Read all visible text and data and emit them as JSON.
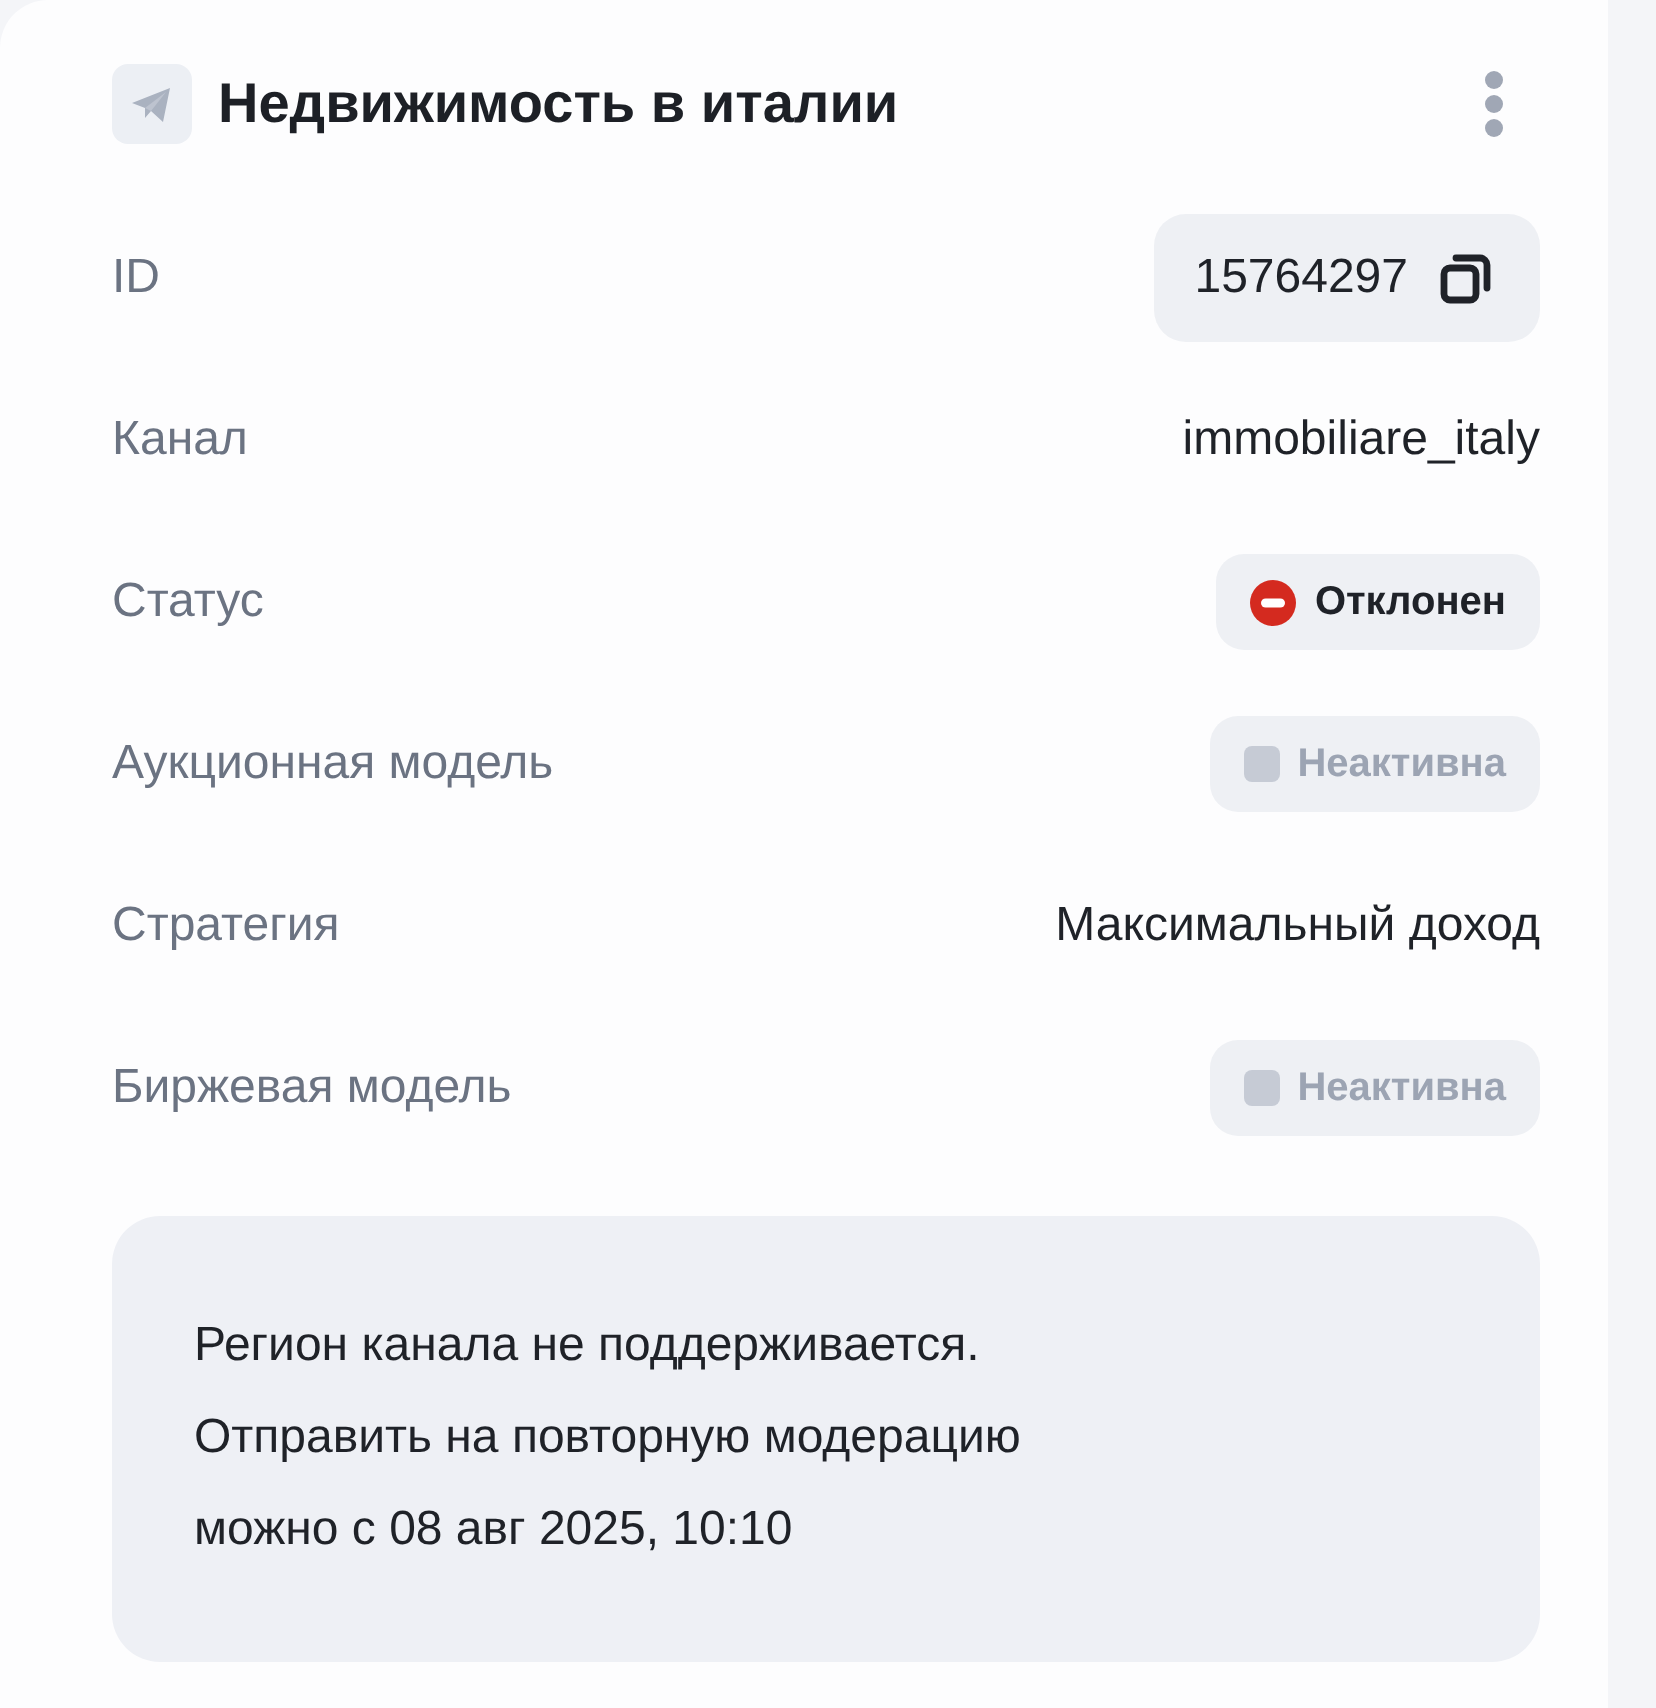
{
  "header": {
    "title": "Недвижимость в италии"
  },
  "fields": [
    {
      "label": "ID",
      "kind": "copy",
      "value": "15764297"
    },
    {
      "label": "Канал",
      "kind": "text",
      "value": "immobiliare_italy"
    },
    {
      "label": "Статус",
      "kind": "status",
      "value": "Отклонен",
      "color": "#d42a1f"
    },
    {
      "label": "Аукционная модель",
      "kind": "toggle",
      "value": "Неактивна",
      "active": false
    },
    {
      "label": "Стратегия",
      "kind": "text",
      "value": "Максимальный доход"
    },
    {
      "label": "Биржевая модель",
      "kind": "toggle",
      "value": "Неактивна",
      "active": false
    }
  ],
  "notice": {
    "lines": [
      "Регион канала не поддерживается.",
      "Отправить на повторную модерацию",
      "можно с 08 авг 2025, 10:10"
    ]
  }
}
